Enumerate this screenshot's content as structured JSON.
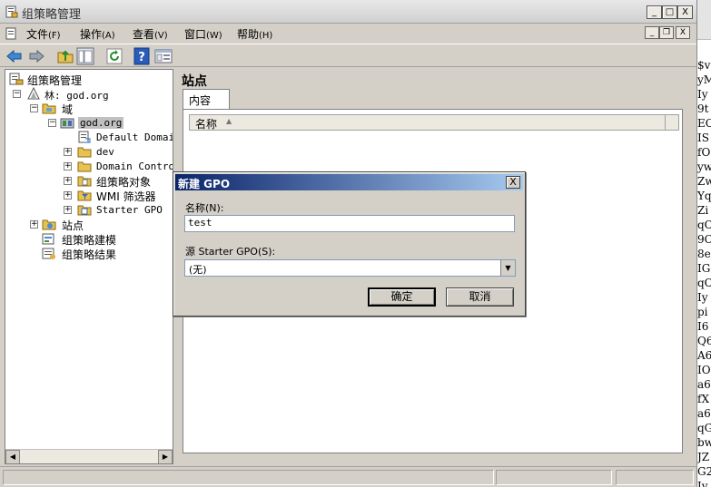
{
  "window": {
    "title": "组策略管理",
    "caption_buttons": [
      "_",
      "□",
      "X"
    ],
    "mdi_buttons": [
      "_",
      "❐",
      "X"
    ]
  },
  "menu": {
    "file": {
      "label": "文件",
      "mnemonic": "(F)"
    },
    "action": {
      "label": "操作",
      "mnemonic": "(A)"
    },
    "view": {
      "label": "查看",
      "mnemonic": "(V)"
    },
    "window": {
      "label": "窗口",
      "mnemonic": "(W)"
    },
    "help": {
      "label": "帮助",
      "mnemonic": "(H)"
    }
  },
  "toolbar": {
    "icons": [
      "back-arrow-icon",
      "forward-arrow-icon",
      "up-folder-icon",
      "show-hide-tree-icon",
      "refresh-icon",
      "help-icon",
      "properties-icon"
    ]
  },
  "tree": {
    "root": "组策略管理",
    "forest": "林: god.org",
    "domains": "域",
    "domain": "god.org",
    "default_domain": "Default Domain",
    "dev": "dev",
    "domain_controllers": "Domain Control",
    "gpo_objects": "组策略对象",
    "wmi_filters": "WMI 筛选器",
    "starter_gpo": "Starter GPO",
    "sites": "站点",
    "gp_modeling": "组策略建模",
    "gp_results": "组策略结果",
    "expander_plus": "+",
    "expander_minus": "−"
  },
  "right_pane": {
    "title": "站点",
    "tab": "内容",
    "column_name": "名称",
    "sort_indicator": "▲"
  },
  "dialog": {
    "title": "新建 GPO",
    "close": "X",
    "name_label": "名称(N):",
    "name_value": "test",
    "source_label": "源 Starter GPO(S):",
    "source_value": "(无)",
    "ok": "确定",
    "cancel": "取消"
  },
  "background_strip": {
    "lines": [
      "$v",
      "yM",
      "Iy",
      "9t",
      "EO",
      "IS",
      "fO",
      "yw",
      "Zw",
      "Yq",
      "Zi",
      "qO",
      "9C",
      "8e",
      "IG",
      "qO",
      "Iy",
      "pi",
      "I6",
      "Q6",
      "A6",
      "IO",
      "a6",
      "fX",
      "a6",
      "qG",
      "bw",
      "JZ",
      "G2",
      "Iy"
    ]
  }
}
